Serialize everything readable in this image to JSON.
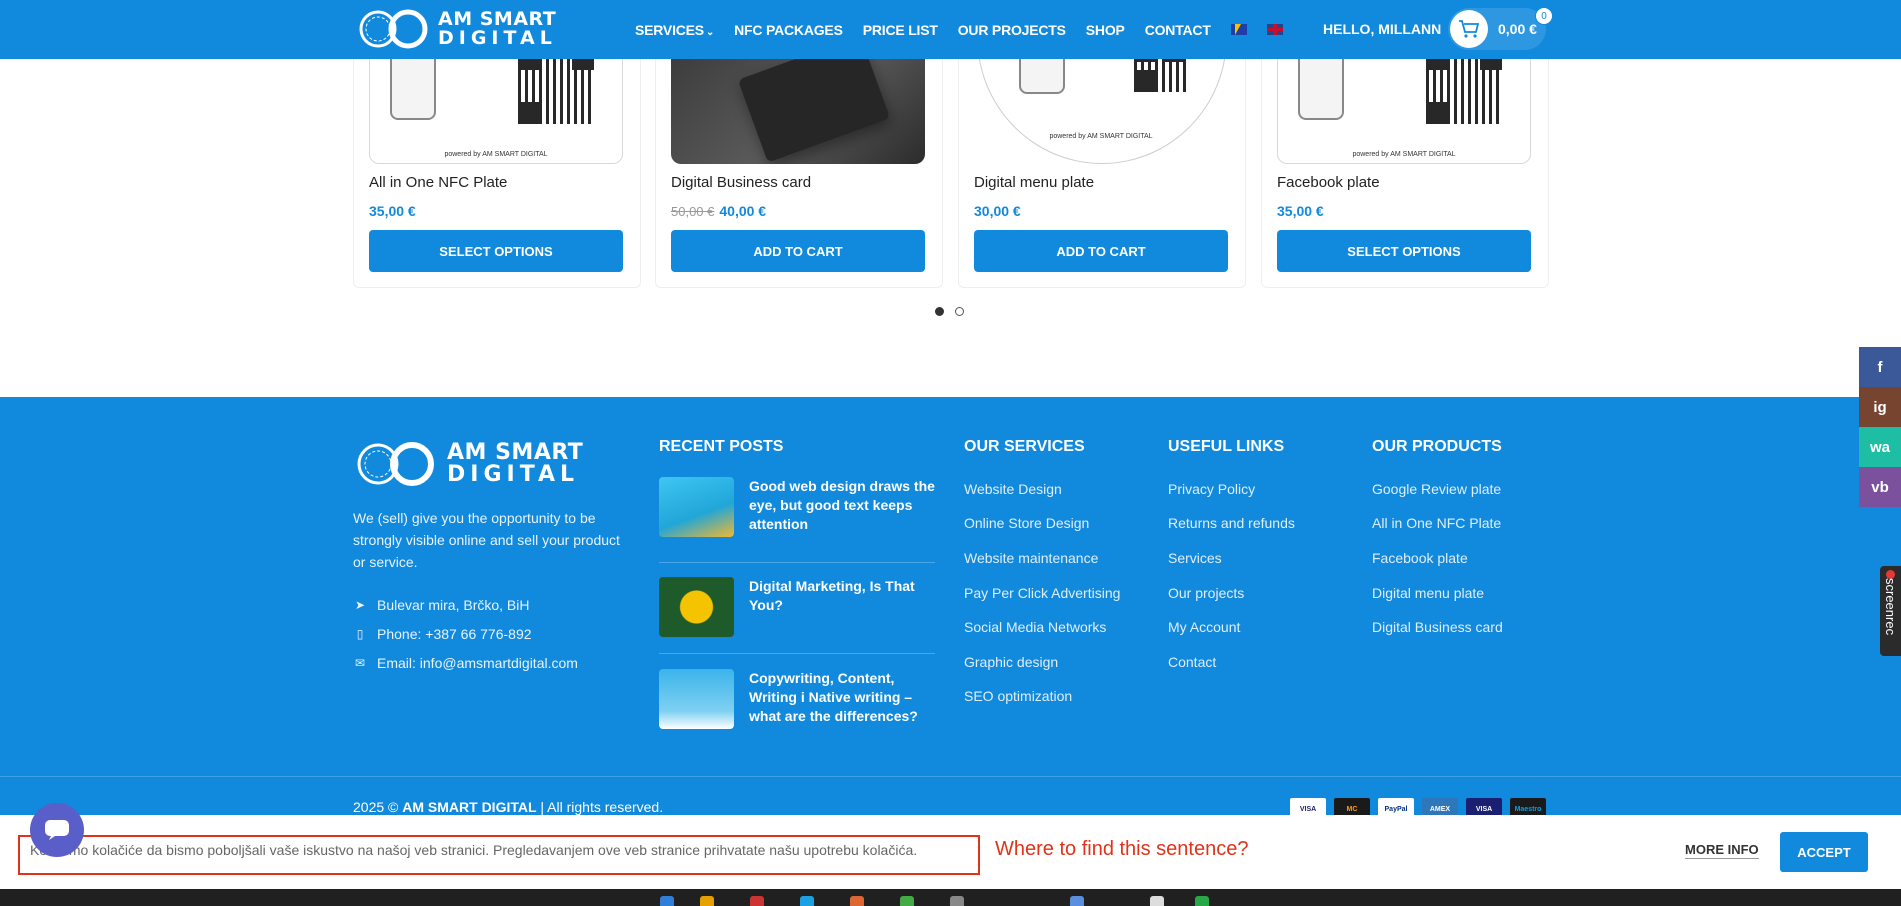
{
  "header": {
    "logo_line1": "AM SMART",
    "logo_line2": "DIGITAL",
    "nav": [
      "SERVICES",
      "NFC PACKAGES",
      "PRICE LIST",
      "OUR PROJECTS",
      "SHOP",
      "CONTACT"
    ],
    "greeting": "HELLO, MILLANN",
    "cart_total": "0,00 €",
    "cart_count": "0"
  },
  "products": [
    {
      "name": "All in One NFC Plate",
      "old_price": "",
      "price": "35,00 €",
      "button": "SELECT OPTIONS",
      "powered": "powered by AM SMART DIGITAL"
    },
    {
      "name": "Digital Business card",
      "old_price": "50,00 €",
      "price": "40,00 €",
      "button": "ADD TO CART",
      "powered": ""
    },
    {
      "name": "Digital menu plate",
      "old_price": "",
      "price": "30,00 €",
      "button": "ADD TO CART",
      "powered": "powered by AM SMART DIGITAL"
    },
    {
      "name": "Facebook plate",
      "old_price": "",
      "price": "35,00 €",
      "button": "SELECT OPTIONS",
      "powered": "powered by AM SMART DIGITAL"
    }
  ],
  "footer": {
    "about": "We (sell) give you the opportunity to be strongly visible online and sell your product or service.",
    "address": "Bulevar mira, Brčko, BiH",
    "phone": "Phone: +387 66 776-892",
    "email": "Email: info@amsmartdigital.com",
    "recent_posts_title": "RECENT POSTS",
    "posts": [
      "Good web design draws the eye, but good text keeps attention",
      "Digital Marketing, Is That You?",
      "Copywriting, Content, Writing i Native writing – what are the differences?"
    ],
    "services_title": "OUR SERVICES",
    "services": [
      "Website Design",
      "Online Store Design",
      "Website maintenance",
      "Pay Per Click Advertising",
      "Social Media Networks",
      "Graphic design",
      "SEO optimization"
    ],
    "links_title": "USEFUL LINKS",
    "links": [
      "Privacy Policy",
      "Returns and refunds",
      "Services",
      "Our projects",
      "My Account",
      "Contact"
    ],
    "products_title": "OUR PRODUCTS",
    "products": [
      "Google Review plate",
      "All in One NFC Plate",
      "Facebook plate",
      "Digital menu plate",
      "Digital Business card"
    ],
    "copyright_prefix": "2025 ©",
    "copyright_brand": "AM SMART DIGITAL",
    "copyright_suffix": "| All rights reserved.",
    "payments": [
      "VISA",
      "MC",
      "PayPal",
      "AMEX",
      "VISA",
      "Maestro"
    ]
  },
  "social": [
    "f",
    "ig",
    "wa",
    "vb"
  ],
  "screenrec_label": "screenrec",
  "cookie": {
    "text": "Koristimo kolačiće da bismo poboljšali vaše iskustvo na našoj veb stranici. Pregledavanjem ove veb stranice prihvatate našu upotrebu kolačića.",
    "more_info": "MORE INFO",
    "accept": "ACCEPT"
  },
  "annotation": "Where to find this sentence?",
  "colors": {
    "brand": "#1189dc",
    "annotation": "#e0331a"
  }
}
